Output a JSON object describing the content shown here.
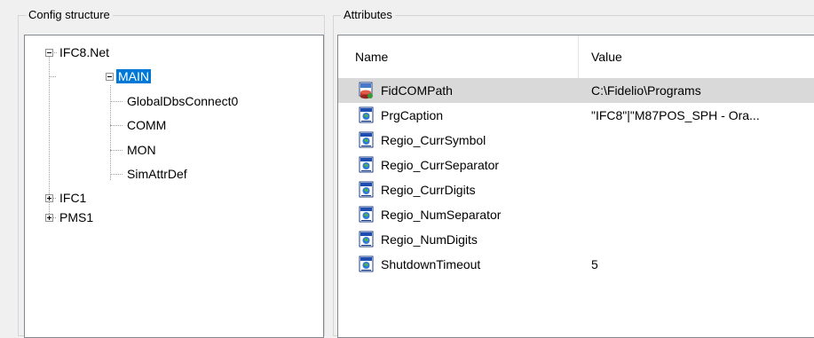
{
  "config_structure": {
    "title": "Config structure",
    "tree": {
      "root": "IFC8.Net",
      "main": "MAIN",
      "main_children": [
        "GlobalDbsConnect0",
        "COMM",
        "MON",
        "SimAttrDef"
      ],
      "ifc1": "IFC1",
      "pms1": "PMS1"
    }
  },
  "attributes": {
    "title": "Attributes",
    "columns": {
      "name": "Name",
      "value": "Value"
    },
    "rows": [
      {
        "name": "FidCOMPath",
        "value": "C:\\Fidelio\\Programs",
        "icon": "db-registry-icon"
      },
      {
        "name": "PrgCaption",
        "value": "\"IFC8\"|\"M87POS_SPH - Ora...",
        "icon": "registry-value-icon"
      },
      {
        "name": "Regio_CurrSymbol",
        "value": "",
        "icon": "registry-value-icon"
      },
      {
        "name": "Regio_CurrSeparator",
        "value": "",
        "icon": "registry-value-icon"
      },
      {
        "name": "Regio_CurrDigits",
        "value": "",
        "icon": "registry-value-icon"
      },
      {
        "name": "Regio_NumSeparator",
        "value": "",
        "icon": "registry-value-icon"
      },
      {
        "name": "Regio_NumDigits",
        "value": "",
        "icon": "registry-value-icon"
      },
      {
        "name": "ShutdownTimeout",
        "value": "5",
        "icon": "registry-value-icon"
      }
    ]
  },
  "colors": {
    "selection_blue": "#0078d7",
    "row_selected_gray": "#d9d9d9",
    "panel_border": "#828790"
  }
}
